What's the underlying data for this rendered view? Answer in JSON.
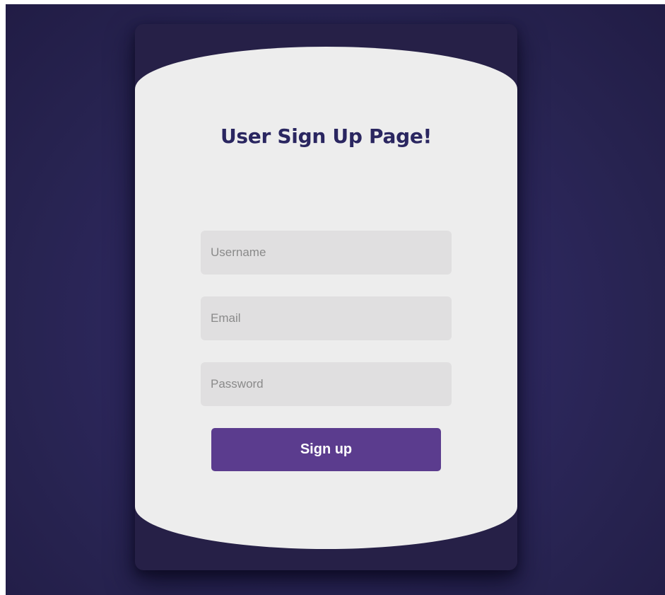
{
  "page": {
    "title": "User Sign Up Page!"
  },
  "form": {
    "username": {
      "value": "",
      "placeholder": "Username"
    },
    "email": {
      "value": "",
      "placeholder": "Email"
    },
    "password": {
      "value": "",
      "placeholder": "Password"
    },
    "submit_label": "Sign up"
  },
  "colors": {
    "background": "#2b2558",
    "card_band": "#262047",
    "card_face": "#ededed",
    "title": "#2a2660",
    "input_bg": "#e0dfe0",
    "button": "#5b3c8e",
    "button_text": "#ffffff"
  }
}
